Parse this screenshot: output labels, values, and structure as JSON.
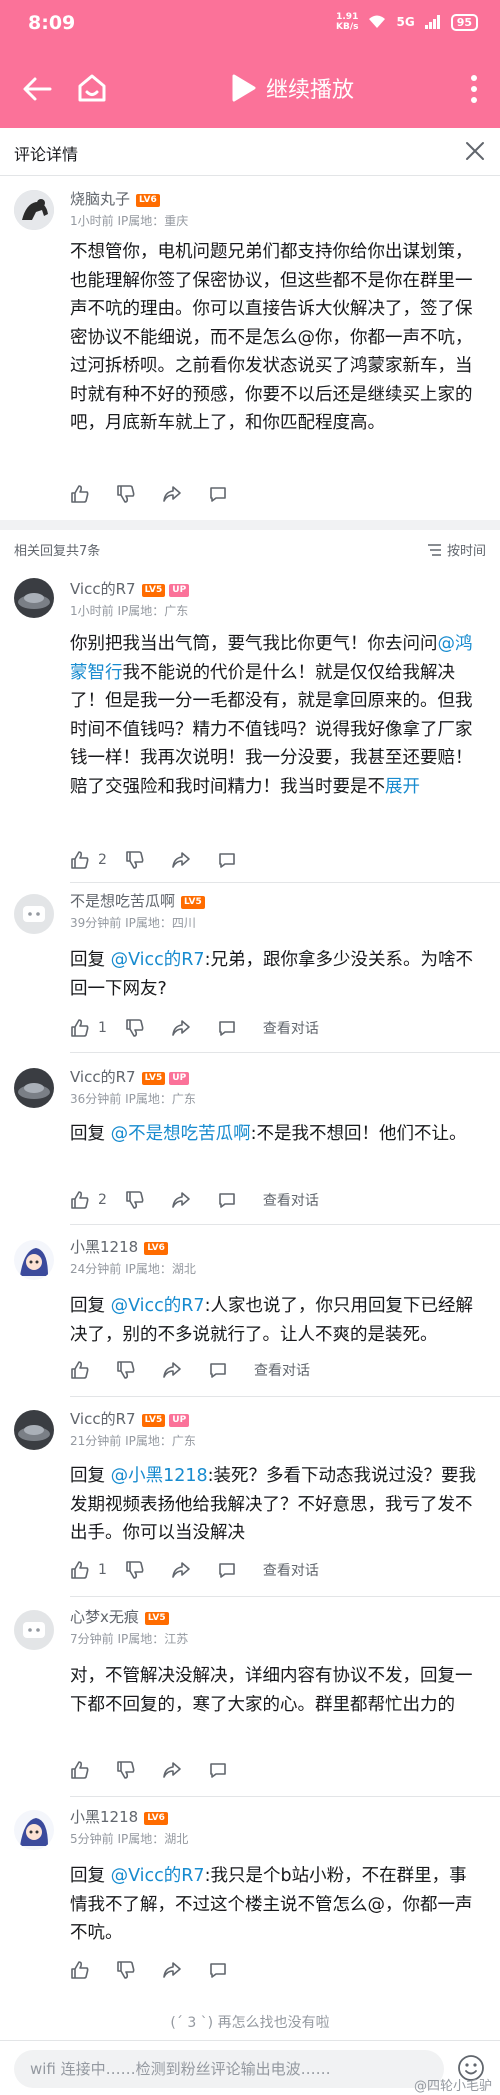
{
  "status_bar": {
    "time": "8:09",
    "net_speed_value": "1.91",
    "net_speed_unit": "KB/s",
    "signal": "5G",
    "battery": "95"
  },
  "title_bar": {
    "play_label": "继续播放"
  },
  "panel": {
    "title": "评论详情"
  },
  "main_comment": {
    "name": "烧脑丸子",
    "level": "LV6",
    "meta": "1小时前 IP属地：重庆",
    "text": "不想管你，电机问题兄弟们都支持你给你出谋划策，也能理解你签了保密协议，但这些都不是你在群里一声不吭的理由。你可以直接告诉大伙解决了，签了保密协议不能细说，而不是怎么@你，你都一声不吭，过河拆桥呗。之前看你发状态说买了鸿蒙家新车，当时就有种不好的预感，你要不以后还是继续买上家的吧，月底新车就上了，和你匹配程度高。"
  },
  "reply_header": {
    "count": "相关回复共7条",
    "sort": "按时间"
  },
  "replies": [
    {
      "name": "Vicc的R7",
      "level": "LV5",
      "up": "UP",
      "meta": "1小时前 IP属地：广东",
      "prefix": "",
      "at": "",
      "text_a": "你别把我当出气筒，要气我比你更气！你去问问",
      "text_at_inline": "@鸿蒙智行",
      "text_b": "我不能说的代价是什么！就是仅仅给我解决了！但是我一分一毛都没有，就是拿回原来的。但我时间不值钱吗？精力不值钱吗？说得我好像拿了厂家钱一样！我再次说明！我一分没要，我甚至还要赔！赔了交强险和我时间精力！我当时要是不",
      "expand": "展开",
      "likes": "2",
      "talk": ""
    },
    {
      "name": "不是想吃苦瓜啊",
      "level": "LV5",
      "meta": "39分钟前 IP属地：四川",
      "prefix": "回复 ",
      "at": "@Vicc的R7",
      "text": ":兄弟，跟你拿多少没关系。为啥不回一下网友?",
      "likes": "1",
      "talk": "查看对话"
    },
    {
      "name": "Vicc的R7",
      "level": "LV5",
      "up": "UP",
      "meta": "36分钟前 IP属地：广东",
      "prefix": "回复 ",
      "at": "@不是想吃苦瓜啊",
      "text": ":不是我不想回！他们不让。",
      "likes": "2",
      "talk": "查看对话"
    },
    {
      "name": "小黑1218",
      "level": "LV6",
      "meta": "24分钟前 IP属地：湖北",
      "prefix": "回复 ",
      "at": "@Vicc的R7",
      "text": ":人家也说了，你只用回复下已经解决了，别的不多说就行了。让人不爽的是装死。",
      "likes": "",
      "talk": "查看对话"
    },
    {
      "name": "Vicc的R7",
      "level": "LV5",
      "up": "UP",
      "meta": "21分钟前 IP属地：广东",
      "prefix": "回复 ",
      "at": "@小黑1218",
      "text": ":装死？多看下动态我说过没？要我发期视频表扬他给我解决了？不好意思，我亏了发不出手。你可以当没解决",
      "likes": "1",
      "talk": "查看对话"
    },
    {
      "name": "心梦x无痕",
      "level": "LV5",
      "meta": "7分钟前 IP属地：江苏",
      "prefix": "",
      "at": "",
      "text": "对，不管解决没解决，详细内容有协议不发，回复一下都不回复的，寒了大家的心。群里都帮忙出力的",
      "likes": "",
      "talk": ""
    },
    {
      "name": "小黑1218",
      "level": "LV6",
      "meta": "5分钟前 IP属地：湖北",
      "prefix": "回复 ",
      "at": "@Vicc的R7",
      "text": ":我只是个b站小粉，不在群里，事情我不了解，不过这个楼主说不管怎么@，你都一声不吭。",
      "likes": "",
      "talk": ""
    }
  ],
  "end_text": "(´ 3 `)  再怎么找也没有啦",
  "bottom": {
    "placeholder": "wifi 连接中……检测到粉丝评论输出电波……",
    "watermark": "@四轮小毛驴"
  },
  "colors": {
    "accent": "#fb7299",
    "link": "#178bcf",
    "level_badge": "#ff6c00"
  }
}
